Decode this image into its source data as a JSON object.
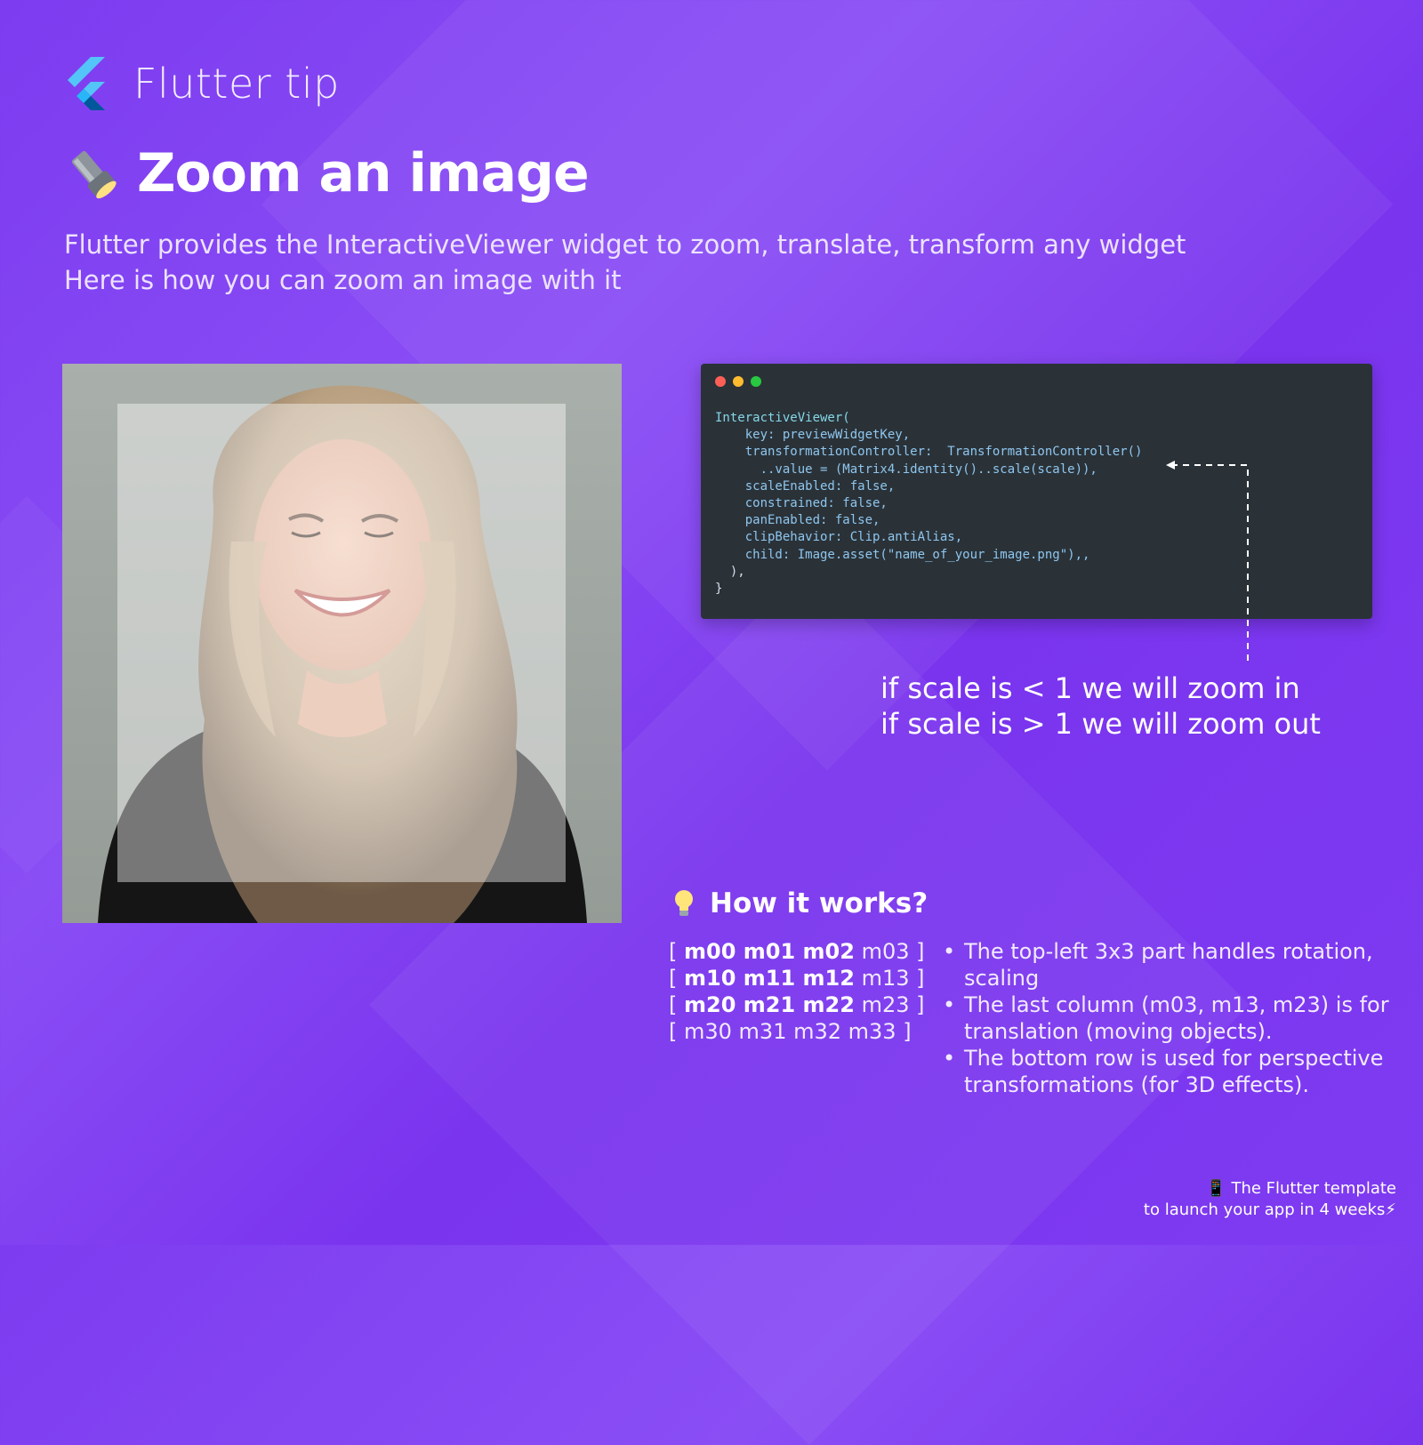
{
  "brand": {
    "name": "Flutter tip",
    "logo_icon": "flutter-logo-icon"
  },
  "title": {
    "emoji_icon": "flashlight-icon",
    "text": "Zoom an image"
  },
  "subtitle": {
    "line1": "Flutter provides the InteractiveViewer widget to zoom, translate, transform any widget",
    "line2": "Here is how you can zoom an image with it"
  },
  "photo": {
    "description_icon": "laughing-woman-photo"
  },
  "code": {
    "window_controls": [
      "close",
      "minimize",
      "maximize"
    ],
    "lines": [
      "InteractiveViewer(",
      "    key: previewWidgetKey,",
      "    transformationController:  TransformationController()",
      "      ..value = (Matrix4.identity()..scale(scale)),",
      "    scaleEnabled: false,",
      "    constrained: false,",
      "    panEnabled: false,",
      "    clipBehavior: Clip.antiAlias,",
      "    child: Image.asset(\"name_of_your_image.png\"),,",
      "  ),",
      "}"
    ]
  },
  "scale_note": {
    "line1": "if scale is < 1 we will zoom in",
    "line2": "if scale is > 1 we will zoom out"
  },
  "how": {
    "icon": "lightbulb-icon",
    "title": "How it works?",
    "matrix_rows": [
      {
        "open": "[ ",
        "bold": "m00 m01 m02",
        "rest": " m03 ]"
      },
      {
        "open": "[ ",
        "bold": "m10  m11 m12",
        "rest": " m13 ]"
      },
      {
        "open": "[ ",
        "bold": "m20  m21 m22",
        "rest": " m23 ]"
      },
      {
        "open": "[ ",
        "bold": "",
        "rest": "m30  m31  m32 m33 ]"
      }
    ],
    "bullets": [
      "The top-left 3x3 part handles rotation, scaling",
      "The last column (m03, m13, m23) is for translation (moving objects).",
      "The bottom row is used for perspective transformations (for 3D effects)."
    ]
  },
  "footer": {
    "line1": "📱 The Flutter template",
    "line2": "to launch your app in 4 weeks⚡"
  }
}
